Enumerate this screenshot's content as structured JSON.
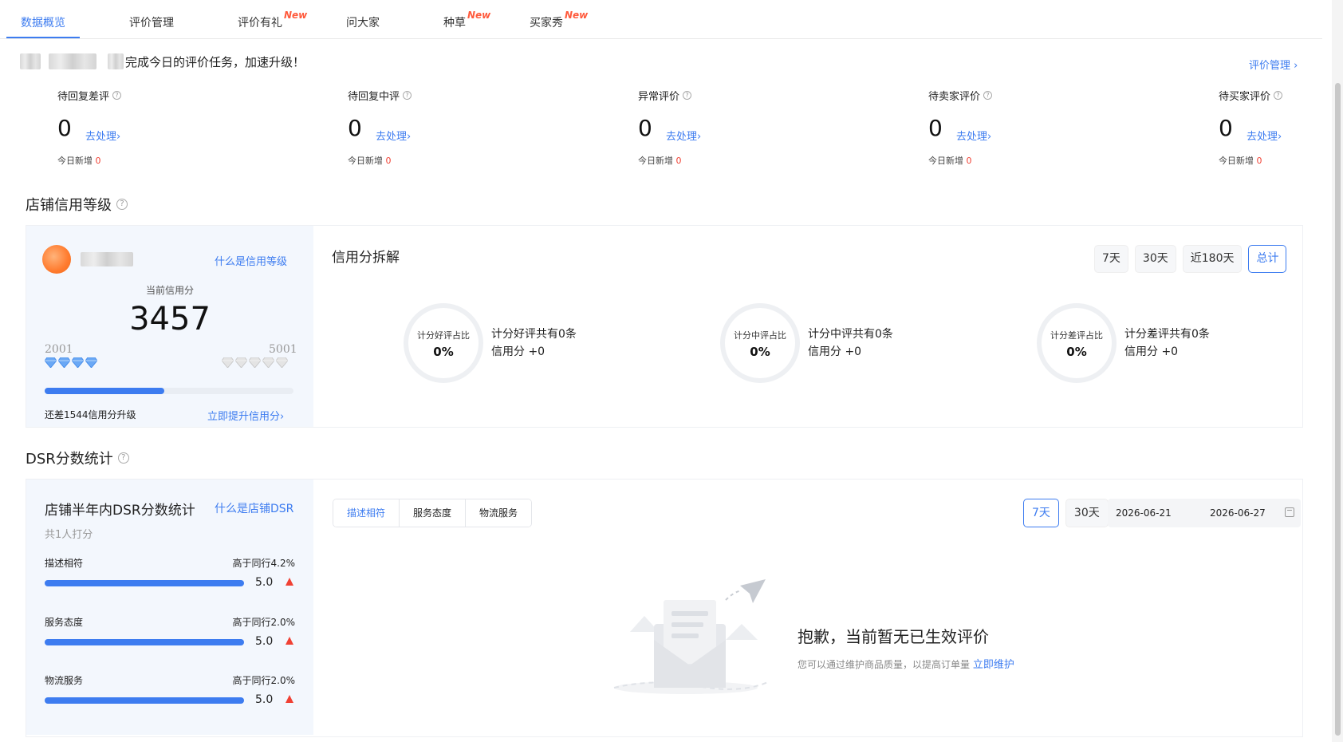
{
  "tabs": [
    {
      "label": "数据概览",
      "new": ""
    },
    {
      "label": "评价管理",
      "new": ""
    },
    {
      "label": "评价有礼",
      "new": "New"
    },
    {
      "label": "问大家",
      "new": ""
    },
    {
      "label": "种草",
      "new": "New"
    },
    {
      "label": "买家秀",
      "new": "New"
    }
  ],
  "greeting": {
    "text": "完成今日的评价任务，加速升级！",
    "link": "评价管理 ›"
  },
  "pending": [
    {
      "title": "待回复差评",
      "value": "0",
      "action": "去处理›",
      "today_label": "今日新增",
      "today_value": "0"
    },
    {
      "title": "待回复中评",
      "value": "0",
      "action": "去处理›",
      "today_label": "今日新增",
      "today_value": "0"
    },
    {
      "title": "异常评价",
      "value": "0",
      "action": "去处理›",
      "today_label": "今日新增",
      "today_value": "0"
    },
    {
      "title": "待卖家评价",
      "value": "0",
      "action": "去处理›",
      "today_label": "今日新增",
      "today_value": "0"
    },
    {
      "title": "待买家评价",
      "value": "0",
      "action": "去处理›",
      "today_label": "今日新增",
      "today_value": "0"
    }
  ],
  "credit": {
    "section_title": "店铺信用等级",
    "what_link": "什么是信用等级",
    "current_label": "当前信用分",
    "current_score": "3457",
    "level_min": "2001",
    "level_max": "5001",
    "progress_fraction": 0.48,
    "upgrade_text": "还差1544信用分升级",
    "raise_link": "立即提升信用分›",
    "breakdown_title": "信用分拆解",
    "periods": [
      "7天",
      "30天",
      "近180天",
      "总计"
    ],
    "active_period": "总计",
    "rings": [
      {
        "label": "计分好评占比",
        "pct": "0%",
        "line1": "计分好评共有0条",
        "line2": "信用分 +0"
      },
      {
        "label": "计分中评占比",
        "pct": "0%",
        "line1": "计分中评共有0条",
        "line2": "信用分 +0"
      },
      {
        "label": "计分差评占比",
        "pct": "0%",
        "line1": "计分差评共有0条",
        "line2": "信用分 +0"
      }
    ]
  },
  "dsr": {
    "section_title": "DSR分数统计",
    "card_title": "店铺半年内DSR分数统计",
    "what_link": "什么是店铺DSR",
    "count": "共1人打分",
    "items": [
      {
        "name": "描述相符",
        "compare": "高于同行4.2%",
        "score": "5.0",
        "fraction": 1.0
      },
      {
        "name": "服务态度",
        "compare": "高于同行2.0%",
        "score": "5.0",
        "fraction": 1.0
      },
      {
        "name": "物流服务",
        "compare": "高于同行2.0%",
        "score": "5.0",
        "fraction": 1.0
      }
    ],
    "tabs": [
      "描述相符",
      "服务态度",
      "物流服务"
    ],
    "active_tab": "描述相符",
    "ranges": [
      "7天",
      "30天"
    ],
    "active_range": "7天",
    "date_start": "2026-06-21",
    "date_end": "2026-06-27",
    "empty_title": "抱歉，当前暂无已生效评价",
    "empty_sub": "您可以通过维护商品质量，以提高订单量",
    "empty_link": "立即维护"
  },
  "colors": {
    "accent": "#3d7cf0",
    "danger": "#f04134",
    "new_tag": "#ff5a3c",
    "panel": "#f3f7fd"
  }
}
